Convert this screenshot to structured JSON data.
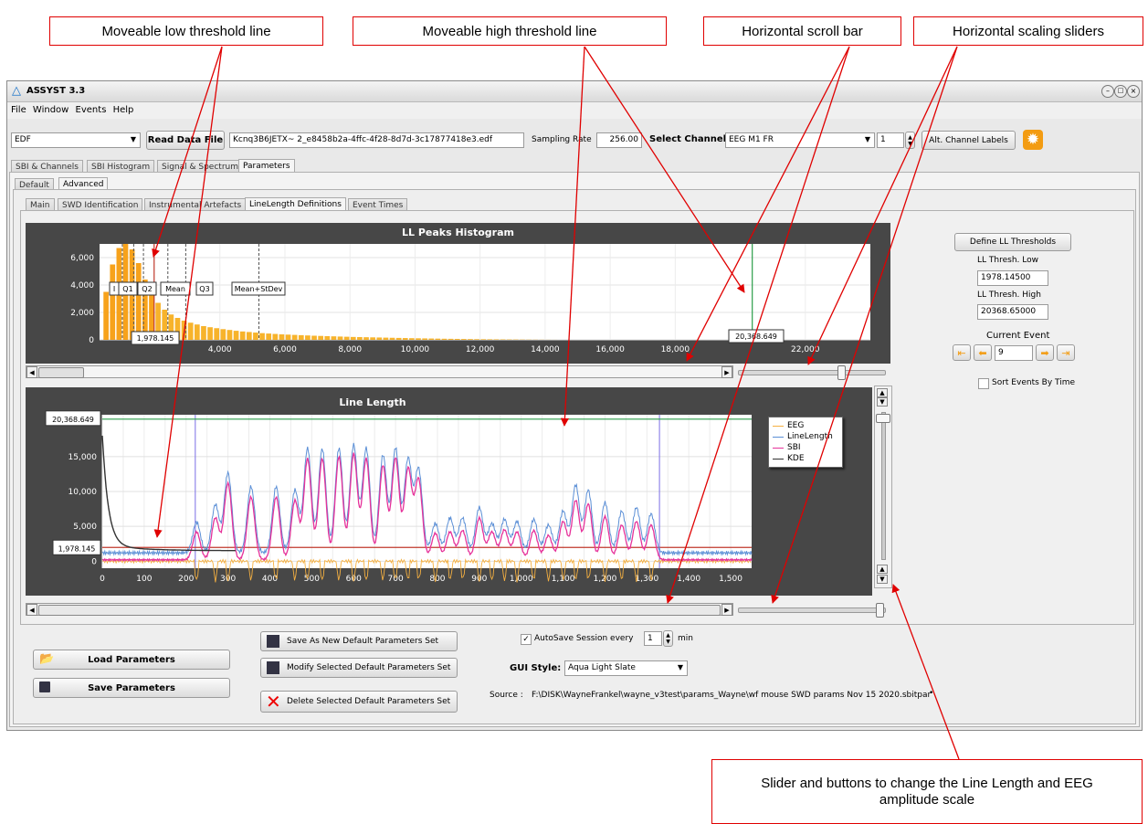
{
  "callouts": {
    "low_line": "Moveable low threshold line",
    "high_line": "Moveable high threshold line",
    "hscroll": "Horizontal scroll bar",
    "hscale": "Horizontal scaling sliders",
    "vscale": "Slider and buttons to change the Line Length and EEG amplitude scale"
  },
  "window": {
    "title": "ASSYST 3.3"
  },
  "menu": [
    "File",
    "Window",
    "Events",
    "Help"
  ],
  "toolbar": {
    "format": "EDF",
    "read_button": "Read Data File",
    "file_name": "Kcnq3B6JETX~ 2_e8458b2a-4ffc-4f28-8d7d-3c17877418e3.edf",
    "sampling_label": "Sampling Rate",
    "sampling_value": "256.00",
    "channel_label": "Select Channel:",
    "channel_value": "EEG M1 FR",
    "channel_index": "1",
    "alt_labels": "Alt. Channel Labels"
  },
  "tabs_top": [
    "SBI & Channels",
    "SBI Histogram",
    "Signal & Spectrum",
    "Parameters"
  ],
  "tabs_mid": [
    "Default",
    "Advanced"
  ],
  "tabs_inner": [
    "Main",
    "SWD Identification",
    "Instrumental Artefacts",
    "LineLength Definitions",
    "Event Times"
  ],
  "side": {
    "define_button": "Define LL Thresholds",
    "low_label": "LL Thresh. Low",
    "low_value": "1978.14500",
    "high_label": "LL Thresh. High",
    "high_value": "20368.65000",
    "current_event_label": "Current Event",
    "current_event_value": "9",
    "sort_label": "Sort Events By Time"
  },
  "hist": {
    "title": "LL Peaks Histogram",
    "y_ticks": [
      "6,000",
      "4,000",
      "2,000",
      "0"
    ],
    "x_ticks": [
      "4,000",
      "6,000",
      "8,000",
      "10,000",
      "12,000",
      "14,000",
      "16,000",
      "18,000",
      "22,000"
    ],
    "stat_labels": [
      "I",
      "Q1",
      "Q2",
      "Mean",
      "Q3",
      "Mean+StDev"
    ],
    "low_value": "1,978.145",
    "high_value": "20,368.649"
  },
  "ll": {
    "title": "Line Length",
    "y_ticks": [
      "15,000",
      "10,000",
      "5,000",
      "0"
    ],
    "x_ticks": [
      "0",
      "100",
      "200",
      "300",
      "400",
      "500",
      "600",
      "700",
      "800",
      "900",
      "1,000",
      "1,100",
      "1,200",
      "1,300",
      "1,400",
      "1,500"
    ],
    "high_value": "20,368.649",
    "low_value": "1,978.145",
    "legend": [
      {
        "name": "EEG",
        "color": "#f5b041"
      },
      {
        "name": "LineLength",
        "color": "#5b8fd6"
      },
      {
        "name": "SBI",
        "color": "#e6329a"
      },
      {
        "name": "KDE",
        "color": "#333333"
      }
    ]
  },
  "bottom": {
    "load": "Load Parameters",
    "save": "Save Parameters",
    "save_new": "Save As New Default Parameters Set",
    "modify": "Modify Selected Default Parameters Set",
    "delete": "Delete Selected Default Parameters Set",
    "autosave": "AutoSave Session every",
    "autosave_value": "1",
    "autosave_unit": "min",
    "gui_label": "GUI Style:",
    "gui_value": "Aqua Light Slate",
    "source_label": "Source :",
    "source_path": "F:\\DISK\\WayneFrankel\\wayne_v3test\\params_Wayne\\wf mouse SWD params Nov 15 2020.sbitpar"
  },
  "chart_data": [
    {
      "type": "bar",
      "title": "LL Peaks Histogram",
      "ylim": [
        0,
        7000
      ],
      "xlim": [
        300,
        24000
      ],
      "thresholds": {
        "low": 1978.145,
        "high": 20368.649
      },
      "note_values": "LL peak counts decay from ~7000 near 1000 to ~0 beyond 14000",
      "x": [
        500,
        700,
        900,
        1100,
        1300,
        1500,
        1700,
        1900,
        2100,
        2300,
        2500,
        2700,
        2900,
        3100,
        3300,
        3500,
        3700,
        3900,
        4100,
        4300,
        4500,
        4700,
        4900,
        5100,
        5300,
        5500,
        5700,
        5900,
        6100,
        6300,
        6500,
        6700,
        6900,
        7100,
        7300,
        7500,
        7700,
        7900,
        8100,
        8300,
        8500,
        8700,
        8900,
        9100,
        9300,
        9500,
        9700,
        9900,
        10100,
        10300,
        10500,
        10700,
        10900,
        11100,
        11300,
        11500,
        11700,
        11900,
        12100,
        12300,
        12500,
        12700,
        12900,
        13100,
        13300,
        13500,
        13700,
        13900,
        14100,
        14300
      ],
      "values": [
        3500,
        5500,
        6700,
        7000,
        6600,
        5600,
        4400,
        3400,
        2700,
        2200,
        1850,
        1600,
        1400,
        1250,
        1120,
        1000,
        920,
        850,
        780,
        720,
        660,
        610,
        570,
        530,
        490,
        460,
        430,
        400,
        380,
        360,
        340,
        320,
        300,
        285,
        270,
        255,
        240,
        225,
        210,
        200,
        190,
        180,
        170,
        160,
        150,
        140,
        130,
        120,
        112,
        104,
        96,
        88,
        80,
        74,
        68,
        62,
        56,
        50,
        45,
        40,
        36,
        32,
        28,
        24,
        20,
        16,
        12,
        9,
        6,
        3
      ]
    },
    {
      "type": "line",
      "title": "Line Length",
      "ylim": [
        -1000,
        21000
      ],
      "xlim": [
        0,
        1550
      ],
      "thresholds": {
        "low": 1978.145,
        "high": 20368.649
      },
      "series": [
        {
          "name": "LineLength",
          "peaks_x": [
            225,
            270,
            300,
            355,
            415,
            460,
            490,
            525,
            565,
            600,
            630,
            670,
            700,
            730,
            755,
            795,
            830,
            860,
            900,
            930,
            960,
            990,
            1030,
            1065,
            1100,
            1130,
            1160,
            1200,
            1240,
            1275,
            1310
          ],
          "peaks_y": [
            4400,
            6900,
            11500,
            9500,
            9500,
            9000,
            15000,
            14900,
            15000,
            15500,
            15000,
            14000,
            15000,
            13400,
            12000,
            4200,
            5000,
            5000,
            6500,
            4200,
            4800,
            4500,
            4800,
            4000,
            6000,
            9700,
            9000,
            7200,
            6000,
            6500,
            5600
          ]
        },
        {
          "name": "SBI",
          "peaks_x": [
            225,
            270,
            300,
            355,
            415,
            460,
            490,
            525,
            565,
            600,
            630,
            670,
            700,
            730,
            755,
            795,
            830,
            860,
            900,
            930,
            960,
            990,
            1030,
            1065,
            1100,
            1130,
            1160,
            1200,
            1240,
            1275,
            1310
          ],
          "peaks_y": [
            4000,
            6000,
            11000,
            9000,
            9000,
            8500,
            14500,
            14500,
            14800,
            15200,
            14500,
            13500,
            14600,
            13000,
            11500,
            3800,
            4000,
            4200,
            6000,
            4000,
            4300,
            4000,
            4200,
            3500,
            5500,
            8500,
            8000,
            6200,
            5000,
            5500,
            5000
          ]
        }
      ]
    }
  ]
}
